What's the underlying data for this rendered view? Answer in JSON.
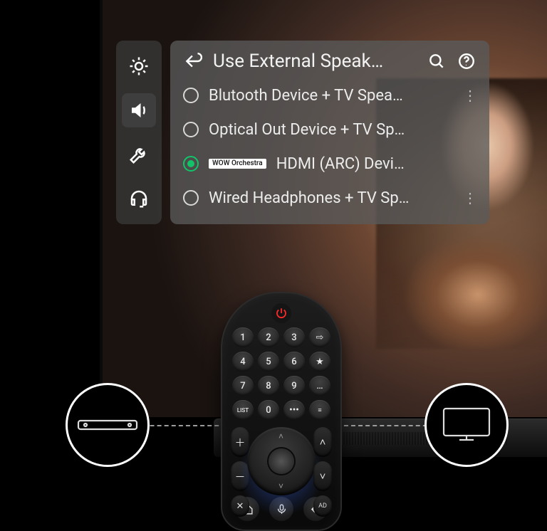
{
  "sidebar": {
    "items": [
      {
        "id": "picture",
        "icon": "brightness",
        "active": false
      },
      {
        "id": "sound",
        "icon": "speaker",
        "active": true
      },
      {
        "id": "general",
        "icon": "wrench",
        "active": false
      },
      {
        "id": "support",
        "icon": "headset",
        "active": false
      }
    ]
  },
  "panel": {
    "title": "Use External Speak…",
    "options": [
      {
        "label": "Blutooth Device + TV Spea…",
        "selected": false,
        "badge": null,
        "has_more": true
      },
      {
        "label": "Optical Out Device + TV Sp…",
        "selected": false,
        "badge": null,
        "has_more": false
      },
      {
        "label": "HDMI (ARC) Devi…",
        "selected": true,
        "badge": "WOW Orchestra",
        "has_more": false
      },
      {
        "label": "Wired Headphones + TV Sp…",
        "selected": false,
        "badge": null,
        "has_more": true
      }
    ]
  },
  "remote": {
    "numpad": [
      "1",
      "2",
      "3",
      "⇨",
      "4",
      "5",
      "6",
      "★",
      "7",
      "8",
      "9",
      "…",
      "LIST",
      "0",
      "•••",
      "≡"
    ]
  },
  "callouts": {
    "left": "LG Soundbar",
    "right": "LG TV"
  }
}
